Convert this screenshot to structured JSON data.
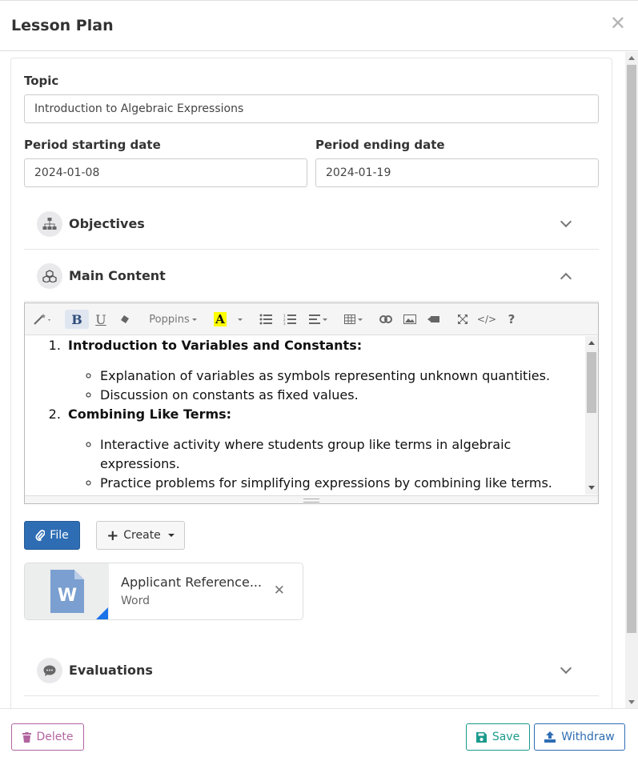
{
  "modal": {
    "title": "Lesson Plan",
    "close_glyph": "✕"
  },
  "form": {
    "topic_label": "Topic",
    "topic_value": "Introduction to Algebraic Expressions",
    "start_label": "Period starting date",
    "start_value": "2024-01-08",
    "end_label": "Period ending date",
    "end_value": "2024-01-19"
  },
  "sections": {
    "objectives": "Objectives",
    "main_content": "Main Content",
    "evaluations": "Evaluations"
  },
  "editor": {
    "font_name": "Poppins",
    "items": [
      {
        "title": "Introduction to Variables and Constants:",
        "bullets": [
          "Explanation of variables as symbols representing unknown quantities.",
          "Discussion on constants as fixed values."
        ]
      },
      {
        "title": "Combining Like Terms:",
        "bullets": [
          "Interactive activity where students group like terms in algebraic expressions.",
          "Practice problems for simplifying expressions by combining like terms."
        ]
      }
    ]
  },
  "actions": {
    "file_label": "File",
    "create_label": "Create"
  },
  "attachment": {
    "name": "Applicant Reference...",
    "type": "Word",
    "icon_letter": "W"
  },
  "footer": {
    "delete_label": "Delete",
    "save_label": "Save",
    "withdraw_label": "Withdraw"
  },
  "colors": {
    "primary": "#2e6db4",
    "save": "#1a9a8c",
    "delete": "#b264a0",
    "word_corner": "#1a73e8"
  }
}
